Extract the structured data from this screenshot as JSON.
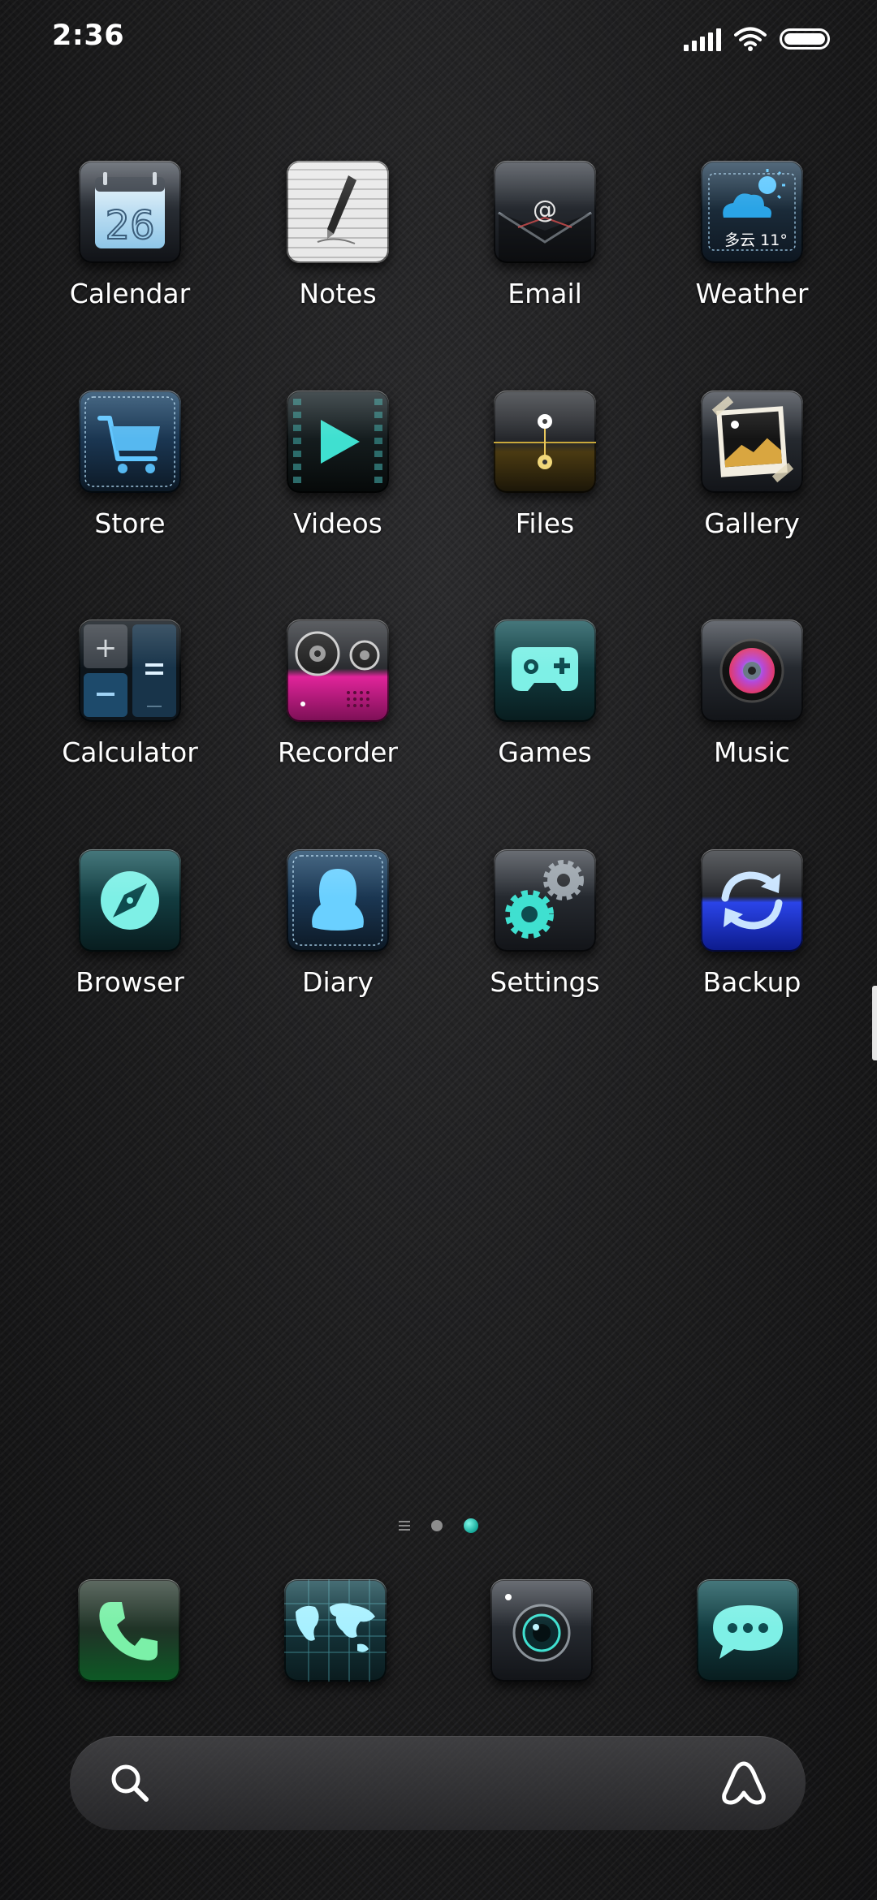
{
  "status_bar": {
    "time": "2:36",
    "signal_icon": "cellular-signal-icon",
    "wifi_icon": "wifi-icon",
    "battery_icon": "battery-icon",
    "battery_level": 1.0
  },
  "home": {
    "apps": [
      {
        "label": "Calendar",
        "icon": "calendar-icon",
        "date": "26"
      },
      {
        "label": "Notes",
        "icon": "notes-icon"
      },
      {
        "label": "Email",
        "icon": "email-icon"
      },
      {
        "label": "Weather",
        "icon": "weather-icon",
        "widget_text": "多云 11°"
      },
      {
        "label": "Store",
        "icon": "store-icon"
      },
      {
        "label": "Videos",
        "icon": "videos-icon"
      },
      {
        "label": "Files",
        "icon": "files-icon"
      },
      {
        "label": "Gallery",
        "icon": "gallery-icon"
      },
      {
        "label": "Calculator",
        "icon": "calculator-icon"
      },
      {
        "label": "Recorder",
        "icon": "recorder-icon"
      },
      {
        "label": "Games",
        "icon": "games-icon"
      },
      {
        "label": "Music",
        "icon": "music-icon"
      },
      {
        "label": "Browser",
        "icon": "browser-icon"
      },
      {
        "label": "Diary",
        "icon": "diary-icon"
      },
      {
        "label": "Settings",
        "icon": "settings-icon"
      },
      {
        "label": "Backup",
        "icon": "backup-icon"
      }
    ]
  },
  "page_indicator": {
    "pages": 3,
    "current_page": 3,
    "first_page_icon": "menu-icon"
  },
  "dock": {
    "apps": [
      {
        "icon": "phone-icon"
      },
      {
        "icon": "globe-icon"
      },
      {
        "icon": "camera-icon"
      },
      {
        "icon": "messages-icon"
      }
    ]
  },
  "search_bar": {
    "search_icon": "search-icon",
    "assistant_icon": "assistant-icon"
  },
  "colors": {
    "accent": "#1fd1c0",
    "background": "#1e1e1f",
    "recorder_accent": "#e0249a",
    "backup_accent": "#2a44e8"
  }
}
